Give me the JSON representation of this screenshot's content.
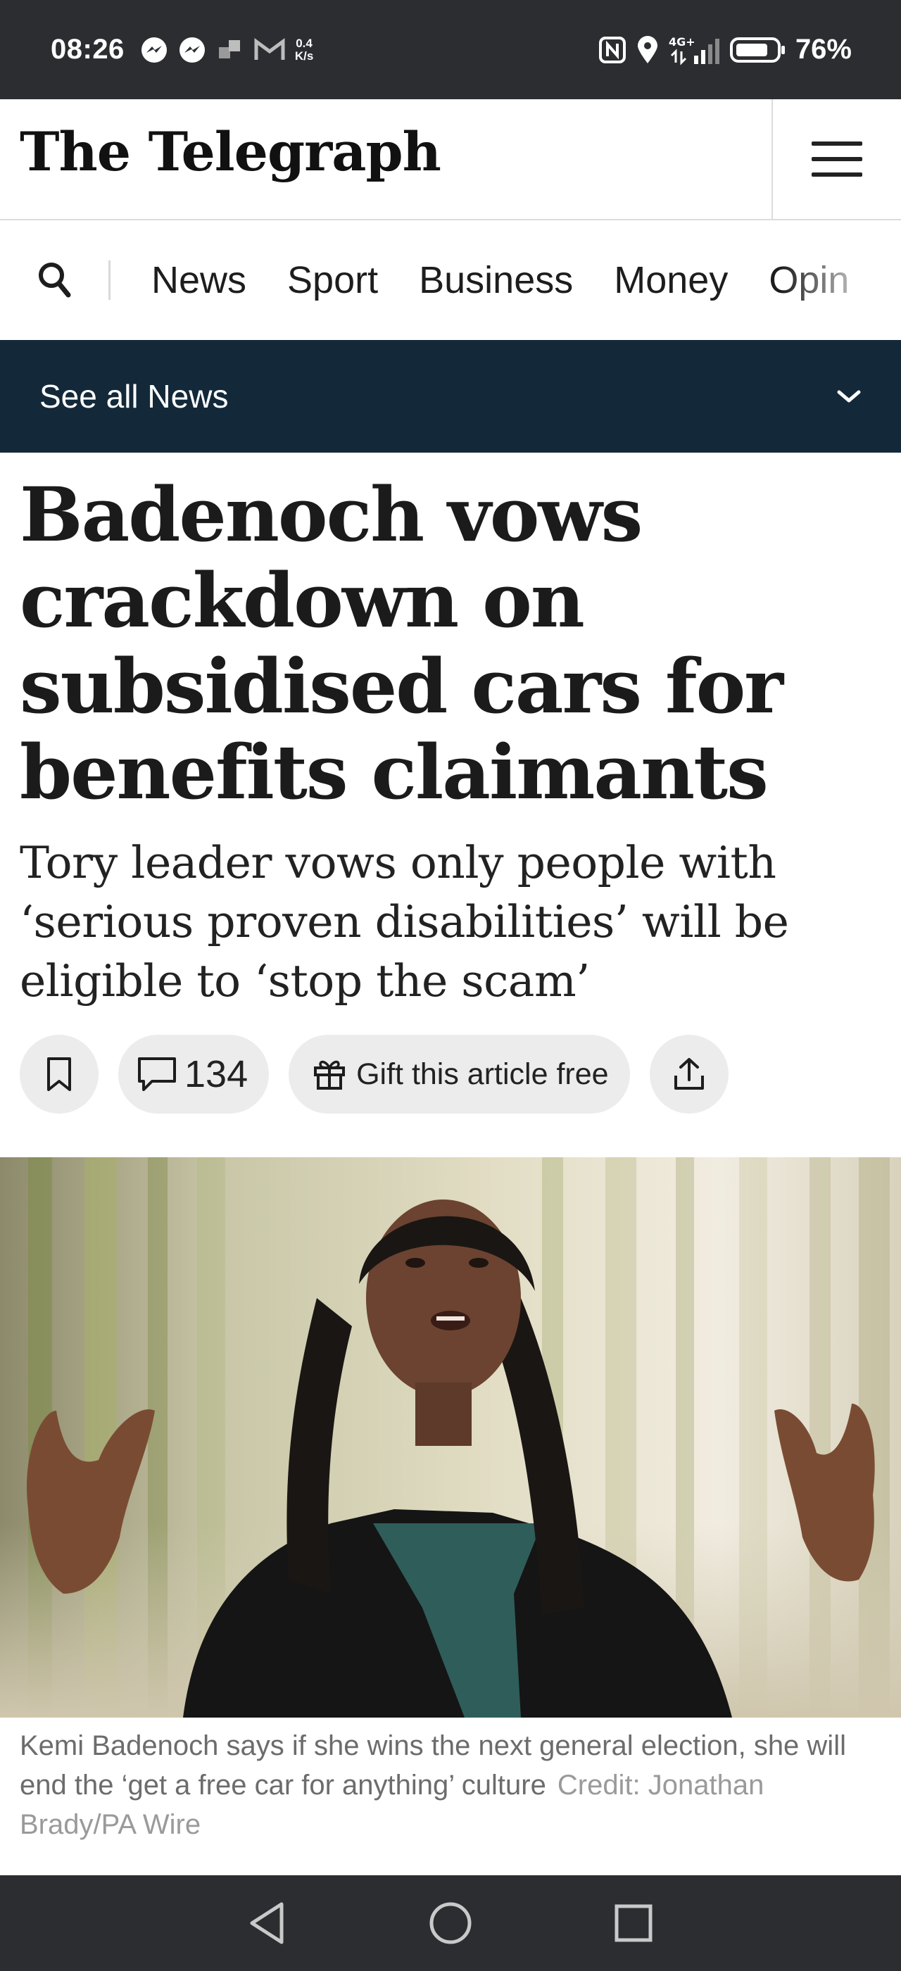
{
  "status_bar": {
    "time": "08:26",
    "net_speed_value": "0.4",
    "net_speed_unit": "K/s",
    "network_type": "4G+",
    "battery": "76%",
    "icons": [
      "messenger-icon",
      "messenger-icon",
      "app-notification-icon",
      "gmail-icon",
      "nfc-icon",
      "location-icon",
      "signal-icon",
      "battery-icon"
    ]
  },
  "masthead": {
    "logo": "The Telegraph",
    "menu_icon": "hamburger-menu-icon"
  },
  "section_nav": {
    "search_icon": "search-icon",
    "items": [
      "News",
      "Sport",
      "Business",
      "Money",
      "Opin"
    ]
  },
  "see_all": {
    "label": "See all News",
    "icon": "chevron-down-icon"
  },
  "article": {
    "headline": "Badenoch vows crackdown on subsidised cars for benefits claimants",
    "standfirst": "Tory leader vows only people with ‘serious proven disabilities’ will be eligible to ‘stop the scam’",
    "actions": {
      "bookmark_icon": "bookmark-icon",
      "comments_icon": "comment-icon",
      "comments_count": "134",
      "gift_icon": "gift-icon",
      "gift_label": "Gift this article free",
      "share_icon": "share-icon"
    },
    "image": {
      "caption": "Kemi Badenoch says if she wins the next general election, she will end the ‘get a free car for anything’ culture",
      "credit": "Credit: Jonathan Brady/PA Wire"
    }
  },
  "system_nav": {
    "buttons": [
      "back-icon",
      "home-icon",
      "recents-icon"
    ]
  },
  "colors": {
    "status_bar_bg": "#2b2d31",
    "see_all_bg": "#13293a",
    "pill_bg": "#ececec",
    "caption_text": "#6c6c6c"
  }
}
